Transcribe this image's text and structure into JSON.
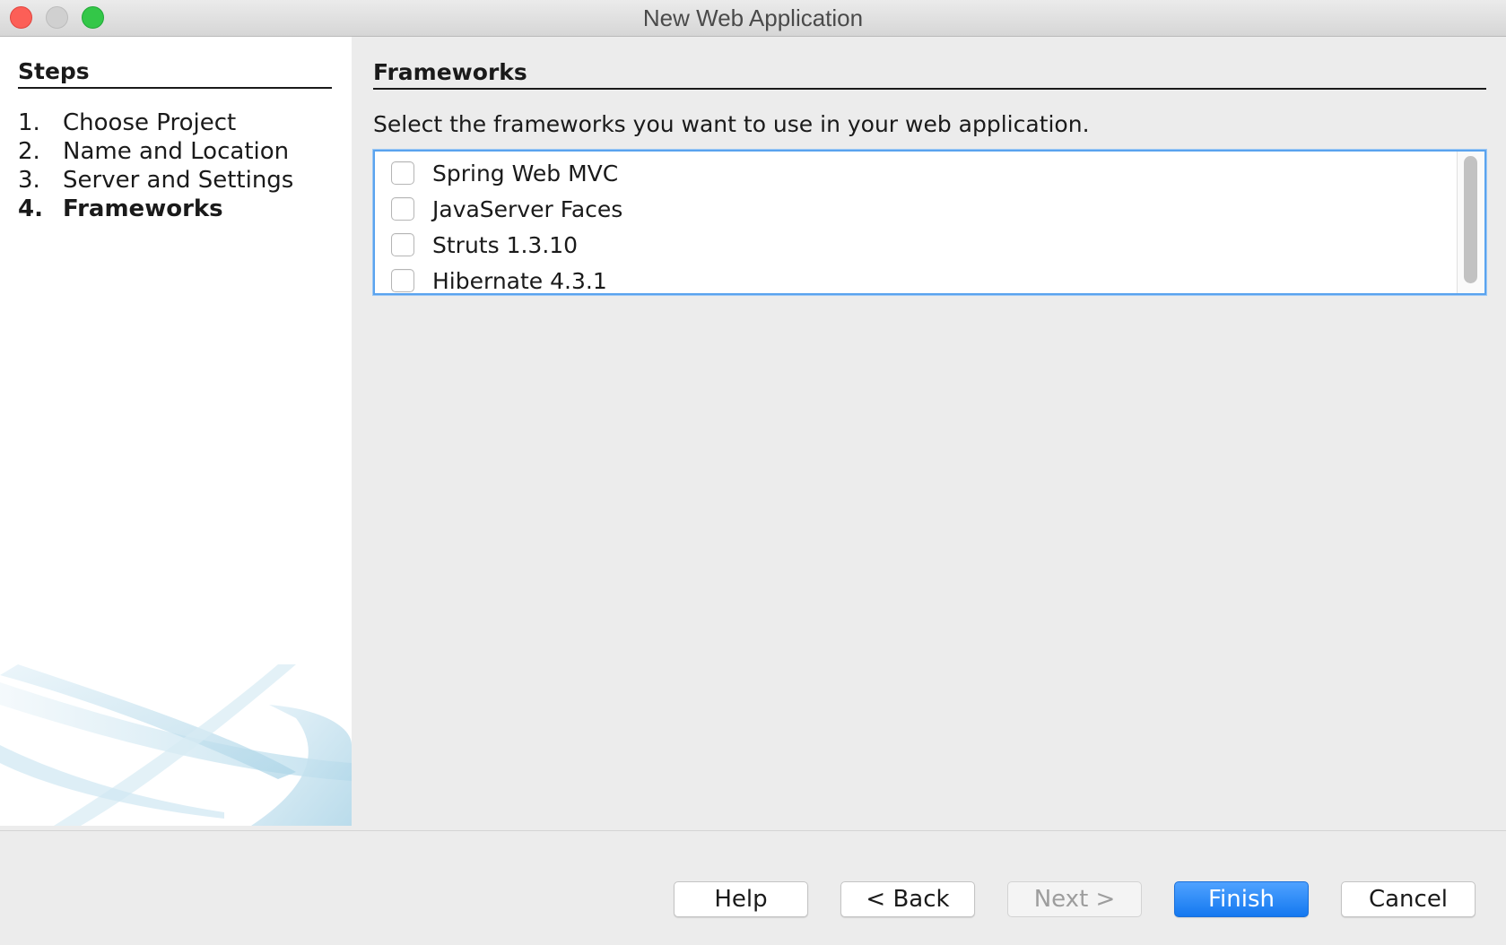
{
  "window": {
    "title": "New Web Application"
  },
  "steps": {
    "heading": "Steps",
    "items": [
      {
        "num": "1.",
        "label": "Choose Project"
      },
      {
        "num": "2.",
        "label": "Name and Location"
      },
      {
        "num": "3.",
        "label": "Server and Settings"
      },
      {
        "num": "4.",
        "label": "Frameworks"
      }
    ],
    "current_index": 3
  },
  "main": {
    "heading": "Frameworks",
    "instructions": "Select the frameworks you want to use in your web application.",
    "frameworks": [
      {
        "label": "Spring Web MVC",
        "checked": false
      },
      {
        "label": "JavaServer Faces",
        "checked": false
      },
      {
        "label": "Struts 1.3.10",
        "checked": false
      },
      {
        "label": "Hibernate 4.3.1",
        "checked": false
      }
    ]
  },
  "buttons": {
    "help": "Help",
    "back": "< Back",
    "next": "Next >",
    "finish": "Finish",
    "cancel": "Cancel"
  },
  "colors": {
    "accent": "#1478f0",
    "focus_border": "#5aa3ee",
    "window_bg": "#ececec"
  }
}
